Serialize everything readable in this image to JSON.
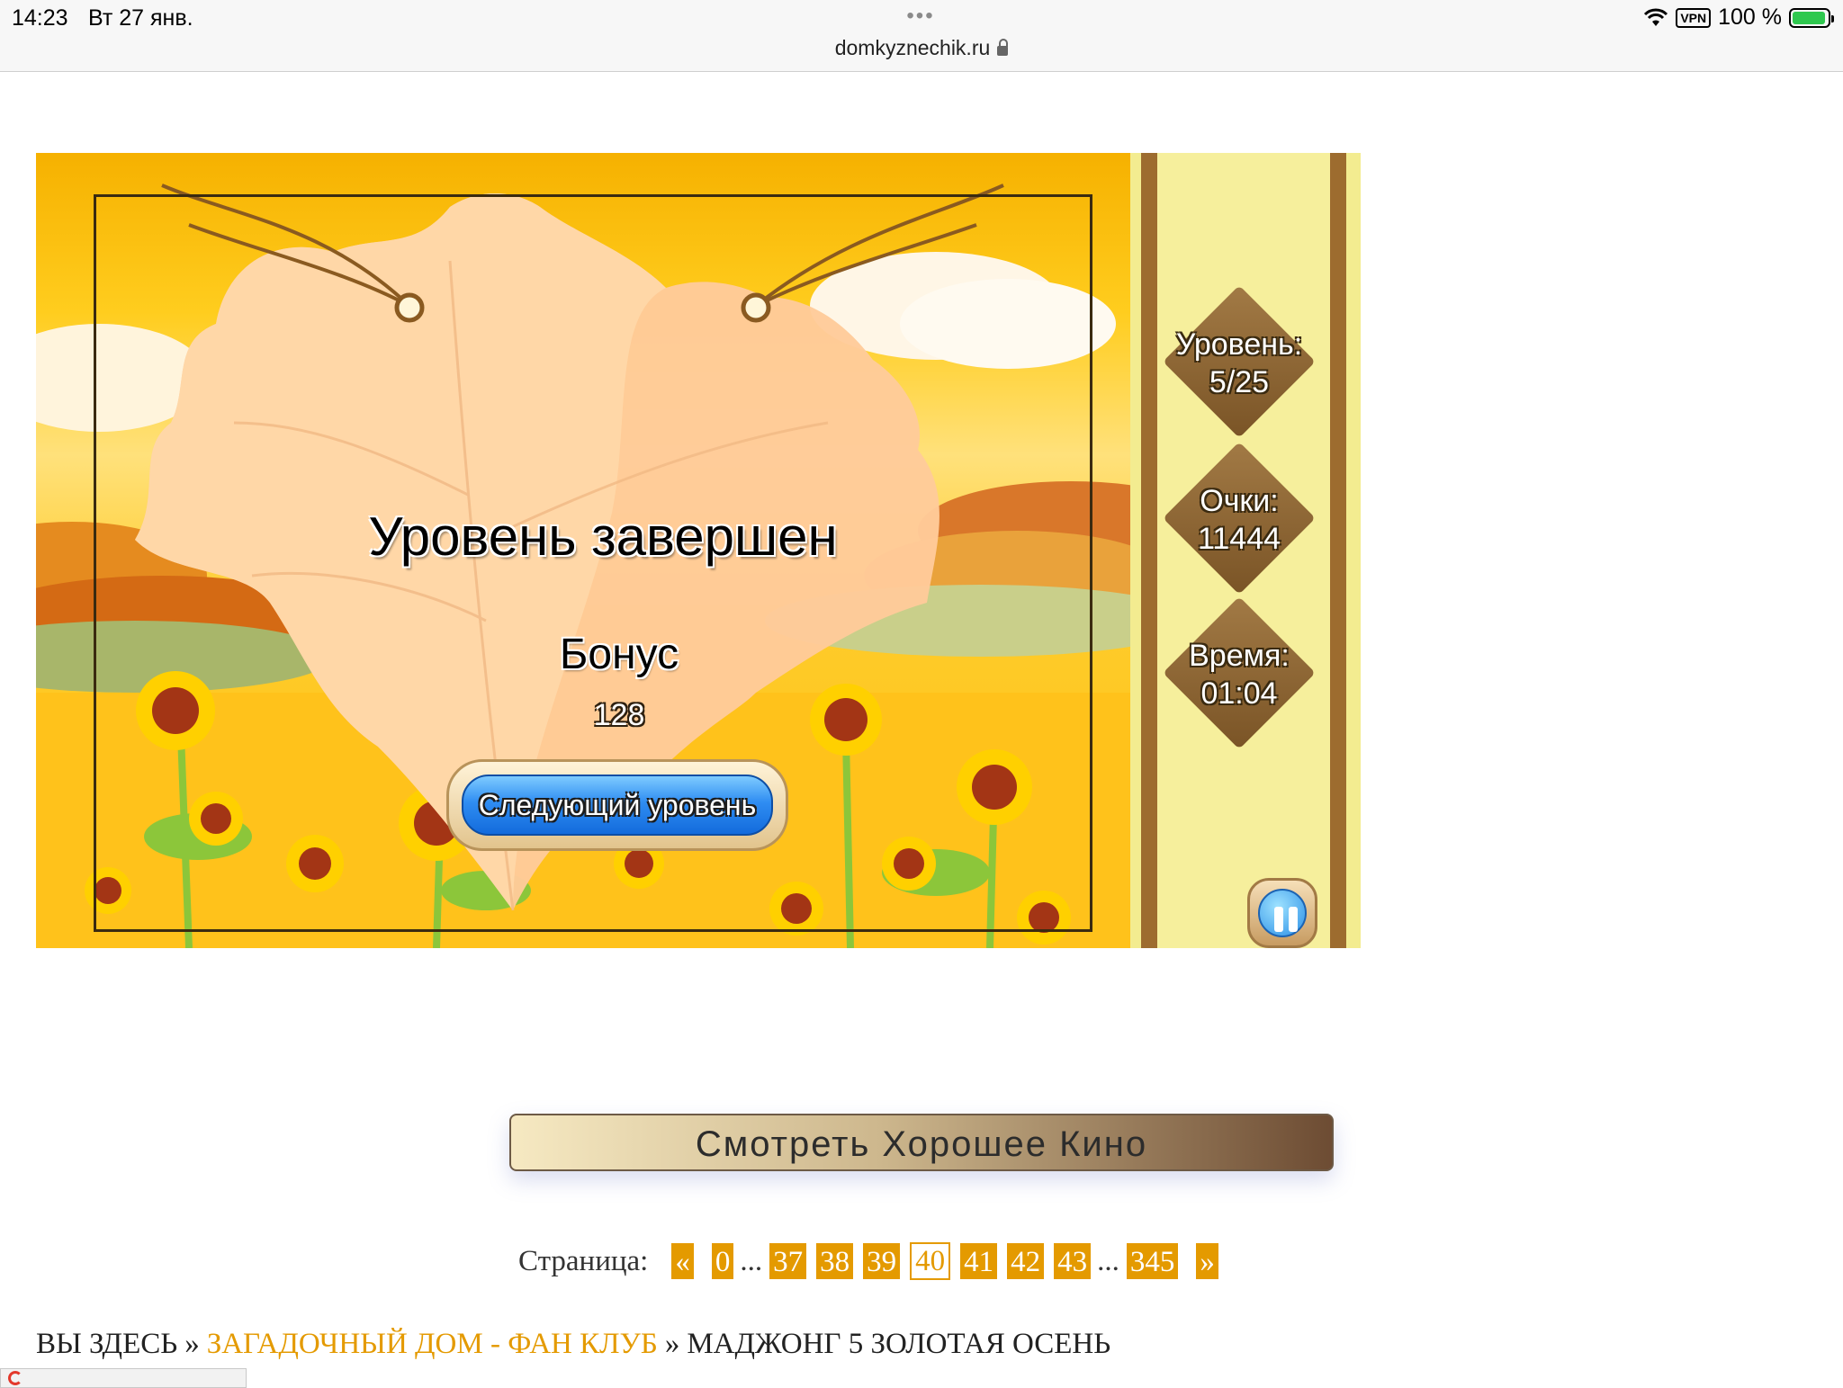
{
  "status_bar": {
    "time": "14:23",
    "date": "Вт 27 янв.",
    "vpn": "VPN",
    "battery": "100 %",
    "battery_fill": 1.0,
    "more_dots": "•••"
  },
  "address": {
    "url": "domkyznechik.ru"
  },
  "game": {
    "title": "Уровень завершен",
    "bonus_label": "Бонус",
    "bonus_value": "128",
    "next_button": "Следующий уровень",
    "level_label": "Уровень:",
    "level_value": "5/25",
    "score_label": "Очки:",
    "score_value": "11444",
    "time_label": "Время:",
    "time_value": "01:04"
  },
  "watch_button": "Смотреть Хорошее Кино",
  "pagination": {
    "label": "Страница:",
    "prev": "«",
    "next": "»",
    "ellipsis": "...",
    "pages": [
      "0",
      "37",
      "38",
      "39",
      "40",
      "41",
      "42",
      "43",
      "345"
    ],
    "current": "40"
  },
  "breadcrumb": {
    "prefix": "ВЫ ЗДЕСЬ",
    "sep": "»",
    "link": "ЗАГАДОЧНЫЙ ДОМ - ФАН КЛУБ",
    "current": "МАДЖОНГ 5 ЗОЛОТАЯ ОСЕНЬ"
  },
  "colors": {
    "accent": "#e49a00",
    "panel": "#f3ec90",
    "button_blue": "#2f8df2"
  },
  "icons": [
    "wifi-icon",
    "lock-icon",
    "battery-icon",
    "pause-icon",
    "headphones-icon",
    "music-note-icon"
  ]
}
